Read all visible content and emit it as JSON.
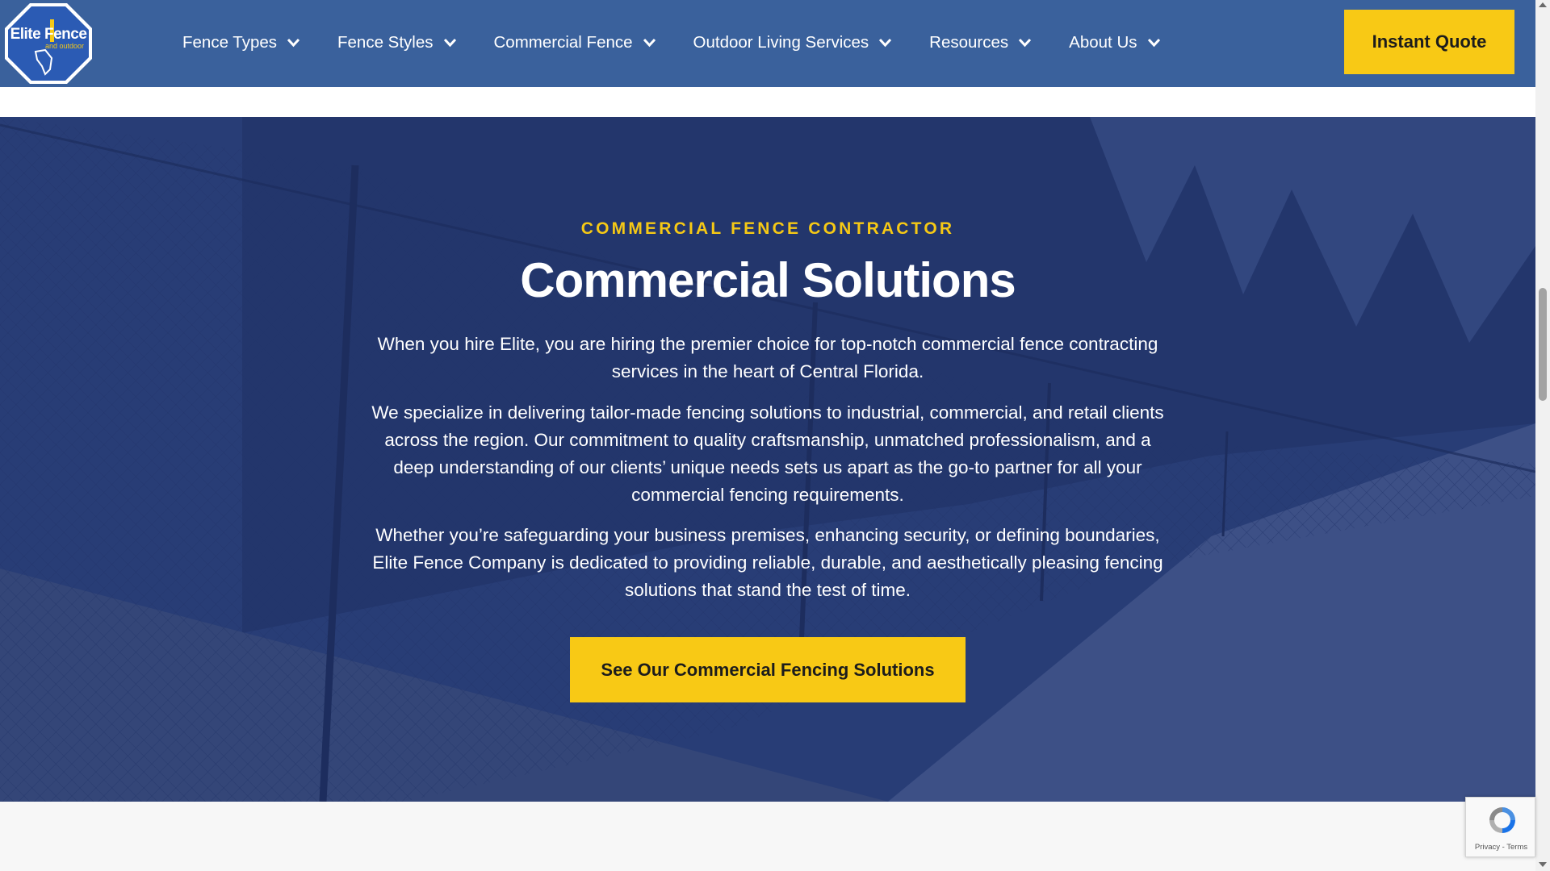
{
  "header": {
    "logo": {
      "name": "Elite Fence",
      "sub": "and outdoor",
      "icon": "octagon-florida-logo"
    },
    "nav": [
      {
        "label": "Fence Types",
        "icon": "chevron-down-icon"
      },
      {
        "label": "Fence Styles",
        "icon": "chevron-down-icon"
      },
      {
        "label": "Commercial Fence",
        "icon": "chevron-down-icon"
      },
      {
        "label": "Outdoor Living Services",
        "icon": "chevron-down-icon"
      },
      {
        "label": "Resources",
        "icon": "chevron-down-icon"
      },
      {
        "label": "About Us",
        "icon": "chevron-down-icon"
      }
    ],
    "cta_label": "Instant Quote"
  },
  "hero": {
    "eyebrow": "COMMERCIAL FENCE CONTRACTOR",
    "title": "Commercial Solutions",
    "paragraphs": [
      "When you hire Elite, you are hiring the premier choice for top-notch commercial fence contracting services in the heart of Central Florida.",
      "We specialize in delivering tailor-made fencing solutions to industrial, commercial, and retail clients across the region. Our commitment to quality craftsmanship, unmatched professionalism, and a deep understanding of our clients’ unique needs sets us apart as the go-to partner for all your commercial fencing requirements.",
      "Whether you’re safeguarding your business premises, enhancing security, or defining boundaries, Elite Fence Company is dedicated to providing reliable, durable, and aesthetically pleasing fencing solutions that stand the test of time."
    ],
    "cta_label": "See Our Commercial Fencing Solutions"
  },
  "recaptcha": {
    "label": "Privacy - Terms",
    "icon": "recaptcha-icon"
  },
  "colors": {
    "header_bg": "#3a619c",
    "accent_yellow": "#f8c915",
    "hero_overlay": "#263c80"
  }
}
